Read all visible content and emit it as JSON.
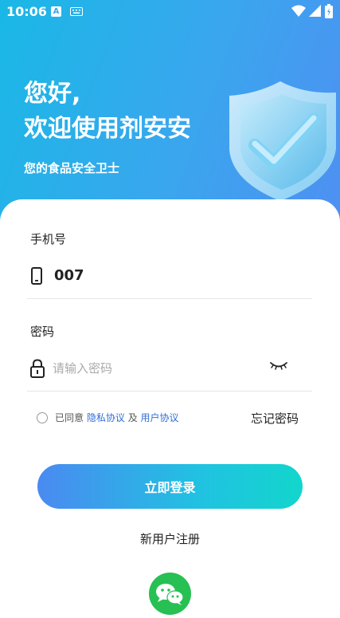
{
  "status_bar": {
    "time": "10:06",
    "a_indicator": "A"
  },
  "header": {
    "greeting": "您好,",
    "welcome": "欢迎使用剂安安",
    "subtitle": "您的食品安全卫士",
    "shield_icon": "shield-check-icon"
  },
  "form": {
    "phone_label": "手机号",
    "phone_value": "007",
    "password_label": "密码",
    "password_placeholder": "请输入密码",
    "password_visibility_icon": "eye-closed-icon"
  },
  "agreement": {
    "prefix": "已同意",
    "privacy_link": "隐私协议",
    "and": "及",
    "user_link": "用户协议",
    "checked": false
  },
  "forgot_password": "忘记密码",
  "login_button": "立即登录",
  "register_link": "新用户注册",
  "social": {
    "wechat_icon": "wechat-icon"
  },
  "colors": {
    "accent_blue": "#2f6fd8",
    "gradient_start": "#4a8af1",
    "gradient_end": "#12d6cc",
    "wechat_green": "#27c053"
  }
}
